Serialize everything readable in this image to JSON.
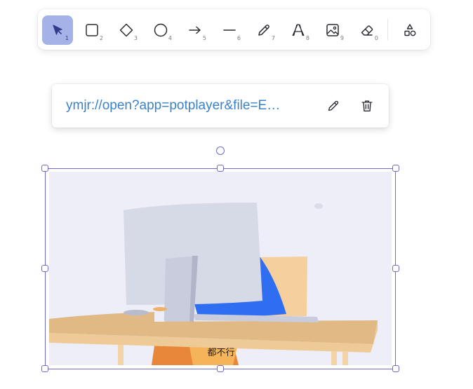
{
  "toolbar": {
    "tools": [
      {
        "name": "selection",
        "key": "1",
        "icon": "pointer-icon",
        "active": true
      },
      {
        "name": "rectangle",
        "key": "2",
        "icon": "square-icon"
      },
      {
        "name": "diamond",
        "key": "3",
        "icon": "diamond-icon"
      },
      {
        "name": "ellipse",
        "key": "4",
        "icon": "circle-icon"
      },
      {
        "name": "arrow",
        "key": "5",
        "icon": "arrow-right-icon"
      },
      {
        "name": "line",
        "key": "6",
        "icon": "line-icon"
      },
      {
        "name": "draw",
        "key": "7",
        "icon": "pencil-icon"
      },
      {
        "name": "text",
        "key": "8",
        "icon": "text-icon"
      },
      {
        "name": "image",
        "key": "9",
        "icon": "image-icon"
      },
      {
        "name": "eraser",
        "key": "0",
        "icon": "eraser-icon"
      },
      {
        "name": "more-shapes",
        "icon": "shapes-icon"
      }
    ],
    "active_color": "#a4b2e8"
  },
  "link_popover": {
    "url": "ymjr://open?app=potplayer&file=E…",
    "link_color": "#3b82c8",
    "edit_icon": "pencil-icon",
    "delete_icon": "trash-icon"
  },
  "canvas": {
    "selection_color": "#6f6ad0",
    "element_label": "都不行"
  }
}
